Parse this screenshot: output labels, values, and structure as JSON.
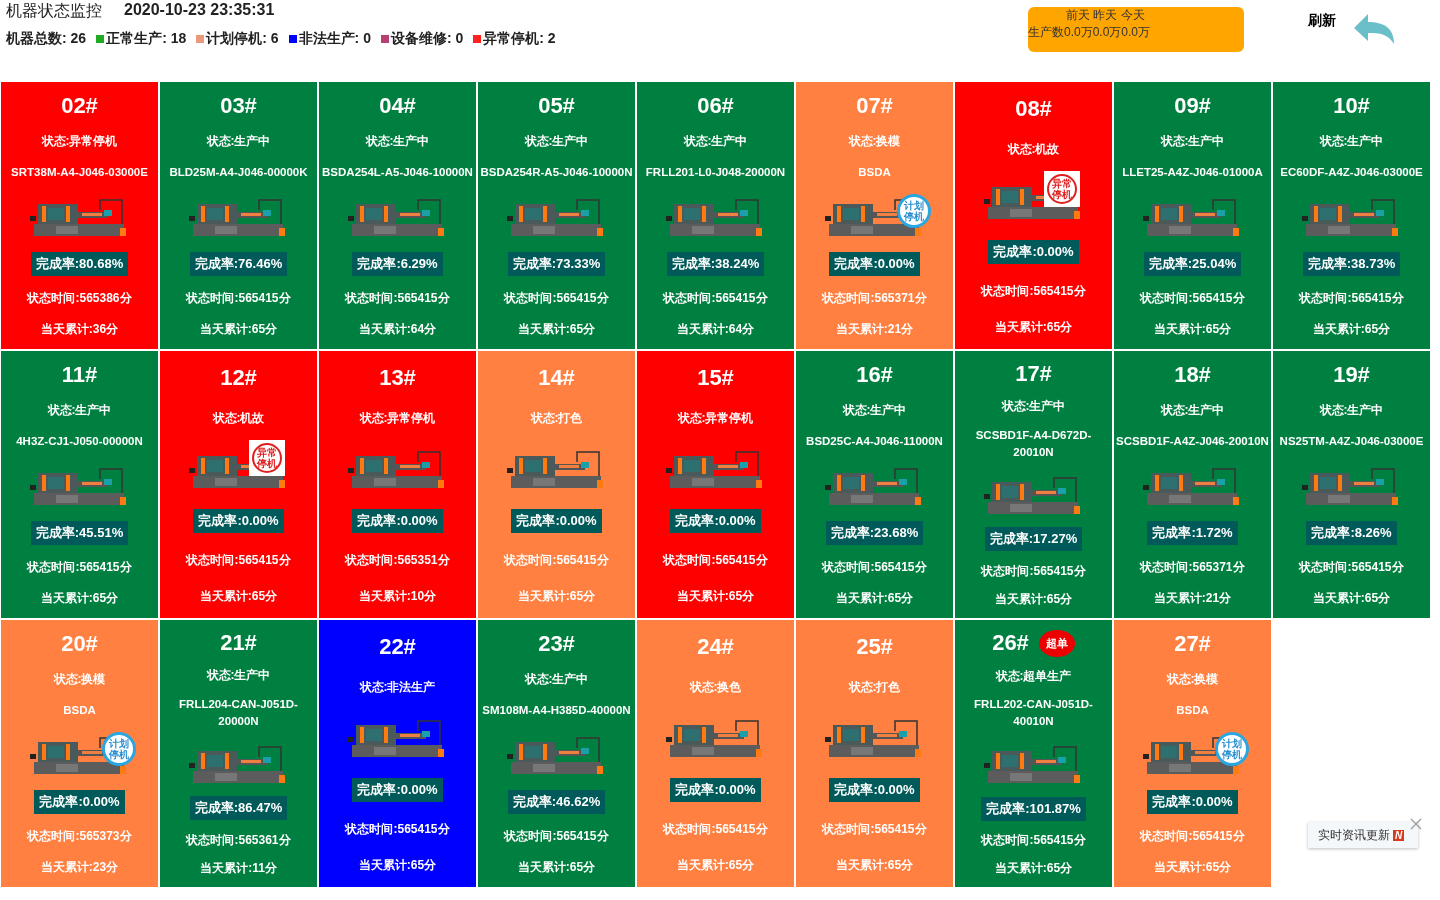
{
  "header": {
    "title": "机器状态监控",
    "datetime": "2020-10-23 23:35:31",
    "total": "机器总数: 26",
    "legend": [
      {
        "label": "正常生产: 18",
        "color": "#22aa22"
      },
      {
        "label": "计划停机: 6",
        "color": "#e99a7a"
      },
      {
        "label": "非法生产: 0",
        "color": "#0000ff"
      },
      {
        "label": "设备维修: 0",
        "color": "#b84070"
      },
      {
        "label": "异常停机: 2",
        "color": "#ff2020"
      }
    ]
  },
  "production_panel": {
    "days": "前天 昨天 今天",
    "counts": "生产数0.0万0.0万0.0万"
  },
  "refresh": {
    "label": "刷新"
  },
  "machines": [
    {
      "id": "02#",
      "status": "状态:异常停机",
      "part": "SRT38M-A4-J046-03000E",
      "rate": "完成率:80.68%",
      "state_time": "状态时间:565386分",
      "today": "当天累计:36分",
      "color": "#ff0000"
    },
    {
      "id": "03#",
      "status": "状态:生产中",
      "part": "BLD25M-A4-J046-00000K",
      "rate": "完成率:76.46%",
      "state_time": "状态时间:565415分",
      "today": "当天累计:65分",
      "color": "#008040"
    },
    {
      "id": "04#",
      "status": "状态:生产中",
      "part": "BSDA254L-A5-J046-10000N",
      "rate": "完成率:6.29%",
      "state_time": "状态时间:565415分",
      "today": "当天累计:64分",
      "color": "#008040"
    },
    {
      "id": "05#",
      "status": "状态:生产中",
      "part": "BSDA254R-A5-J046-10000N",
      "rate": "完成率:73.33%",
      "state_time": "状态时间:565415分",
      "today": "当天累计:65分",
      "color": "#008040"
    },
    {
      "id": "06#",
      "status": "状态:生产中",
      "part": "FRLL201-L0-J048-20000N",
      "rate": "完成率:38.24%",
      "state_time": "状态时间:565415分",
      "today": "当天累计:64分",
      "color": "#008040"
    },
    {
      "id": "07#",
      "status": "状态:换模",
      "part": "BSDA",
      "rate": "完成率:0.00%",
      "state_time": "状态时间:565371分",
      "today": "当天累计:21分",
      "color": "#ff8040",
      "overlay": {
        "kind": "planned",
        "line1": "计划",
        "line2": "停机"
      }
    },
    {
      "id": "08#",
      "status": "状态:机故",
      "rate": "完成率:0.00%",
      "state_time": "状态时间:565415分",
      "today": "当天累计:65分",
      "color": "#ff0000",
      "overlay": {
        "kind": "abnormal",
        "line1": "异常",
        "line2": "停机"
      }
    },
    {
      "id": "09#",
      "status": "状态:生产中",
      "part": "LLET25-A4Z-J046-01000A",
      "rate": "完成率:25.04%",
      "state_time": "状态时间:565415分",
      "today": "当天累计:65分",
      "color": "#008040"
    },
    {
      "id": "10#",
      "status": "状态:生产中",
      "part": "EC60DF-A4Z-J046-03000E",
      "rate": "完成率:38.73%",
      "state_time": "状态时间:565415分",
      "today": "当天累计:65分",
      "color": "#008040"
    },
    {
      "id": "11#",
      "status": "状态:生产中",
      "part": "4H3Z-CJ1-J050-00000N",
      "rate": "完成率:45.51%",
      "state_time": "状态时间:565415分",
      "today": "当天累计:65分",
      "color": "#008040"
    },
    {
      "id": "12#",
      "status": "状态:机故",
      "rate": "完成率:0.00%",
      "state_time": "状态时间:565415分",
      "today": "当天累计:65分",
      "color": "#ff0000",
      "overlay": {
        "kind": "abnormal",
        "line1": "异常",
        "line2": "停机"
      }
    },
    {
      "id": "13#",
      "status": "状态:异常停机",
      "rate": "完成率:0.00%",
      "state_time": "状态时间:565351分",
      "today": "当天累计:10分",
      "color": "#ff0000"
    },
    {
      "id": "14#",
      "status": "状态:打色",
      "rate": "完成率:0.00%",
      "state_time": "状态时间:565415分",
      "today": "当天累计:65分",
      "color": "#ff8040"
    },
    {
      "id": "15#",
      "status": "状态:异常停机",
      "rate": "完成率:0.00%",
      "state_time": "状态时间:565415分",
      "today": "当天累计:65分",
      "color": "#ff0000"
    },
    {
      "id": "16#",
      "status": "状态:生产中",
      "part": "BSD25C-A4-J046-11000N",
      "rate": "完成率:23.68%",
      "state_time": "状态时间:565415分",
      "today": "当天累计:65分",
      "color": "#008040"
    },
    {
      "id": "17#",
      "status": "状态:生产中",
      "part": "SCSBD1F-A4-D672D-20010N",
      "rate": "完成率:17.27%",
      "state_time": "状态时间:565415分",
      "today": "当天累计:65分",
      "color": "#008040"
    },
    {
      "id": "18#",
      "status": "状态:生产中",
      "part": "SCSBD1F-A4Z-J046-20010N",
      "rate": "完成率:1.72%",
      "state_time": "状态时间:565371分",
      "today": "当天累计:21分",
      "color": "#008040"
    },
    {
      "id": "19#",
      "status": "状态:生产中",
      "part": "NS25TM-A4Z-J046-03000E",
      "rate": "完成率:8.26%",
      "state_time": "状态时间:565415分",
      "today": "当天累计:65分",
      "color": "#008040"
    },
    {
      "id": "20#",
      "status": "状态:换模",
      "part": "BSDA",
      "rate": "完成率:0.00%",
      "state_time": "状态时间:565373分",
      "today": "当天累计:23分",
      "color": "#ff8040",
      "overlay": {
        "kind": "planned",
        "line1": "计划",
        "line2": "停机"
      }
    },
    {
      "id": "21#",
      "status": "状态:生产中",
      "part": "FRLL204-CAN-J051D-20000N",
      "rate": "完成率:86.47%",
      "state_time": "状态时间:565361分",
      "today": "当天累计:11分",
      "color": "#008040"
    },
    {
      "id": "22#",
      "status": "状态:非法生产",
      "rate": "完成率:0.00%",
      "state_time": "状态时间:565415分",
      "today": "当天累计:65分",
      "color": "#0000ff"
    },
    {
      "id": "23#",
      "status": "状态:生产中",
      "part": "SM108M-A4-H385D-40000N",
      "rate": "完成率:46.62%",
      "state_time": "状态时间:565415分",
      "today": "当天累计:65分",
      "color": "#008040"
    },
    {
      "id": "24#",
      "status": "状态:换色",
      "rate": "完成率:0.00%",
      "state_time": "状态时间:565415分",
      "today": "当天累计:65分",
      "color": "#ff8040"
    },
    {
      "id": "25#",
      "status": "状态:打色",
      "rate": "完成率:0.00%",
      "state_time": "状态时间:565415分",
      "today": "当天累计:65分",
      "color": "#ff8040"
    },
    {
      "id": "26#",
      "badge": "超单",
      "status": "状态:超单生产",
      "part": "FRLL202-CAN-J051D-40010N",
      "rate": "完成率:101.87%",
      "state_time": "状态时间:565415分",
      "today": "当天累计:65分",
      "color": "#008040"
    },
    {
      "id": "27#",
      "status": "状态:换模",
      "part": "BSDA",
      "rate": "完成率:0.00%",
      "state_time": "状态时间:565415分",
      "today": "当天累计:65分",
      "color": "#ff8040",
      "overlay": {
        "kind": "planned",
        "line1": "计划",
        "line2": "停机"
      }
    }
  ],
  "news_popup": {
    "label": "实时资讯更新",
    "badge": "N"
  }
}
